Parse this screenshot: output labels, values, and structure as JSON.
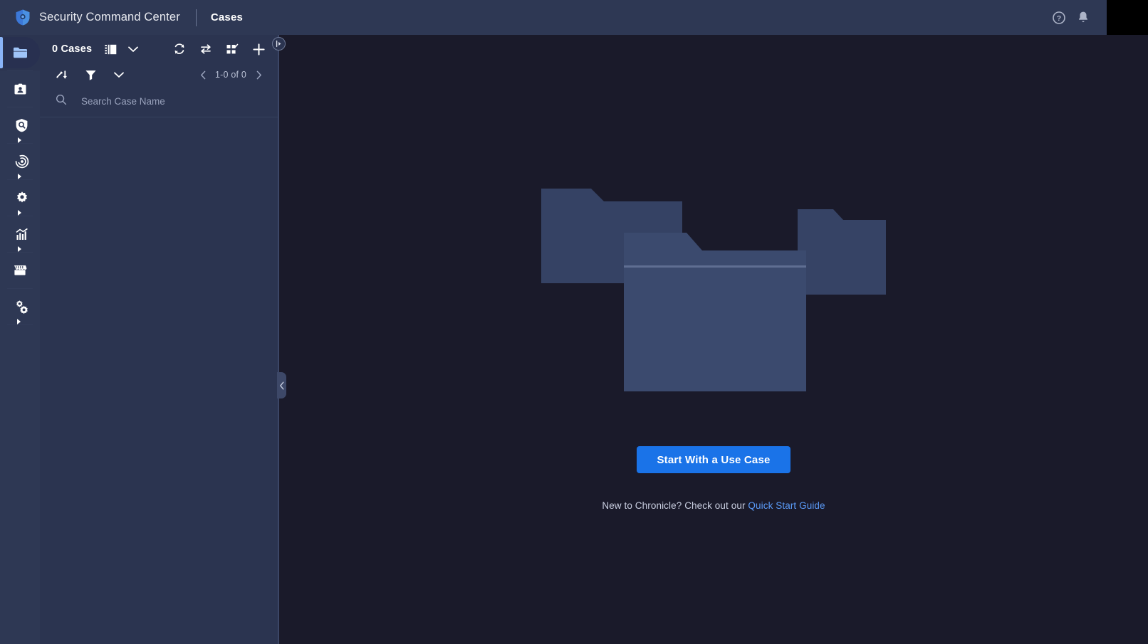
{
  "topbar": {
    "brand": "Security Command Center",
    "section": "Cases",
    "help_icon": "help-circle-icon",
    "notifications_icon": "bell-icon",
    "avatar": "user-avatar"
  },
  "sidebar": {
    "items": [
      {
        "id": "cases",
        "icon": "folder-icon",
        "active": true,
        "expandable": false
      },
      {
        "id": "contacts",
        "icon": "id-badge-icon",
        "active": false,
        "expandable": false
      },
      {
        "id": "investigate",
        "icon": "shield-search-icon",
        "active": false,
        "expandable": true
      },
      {
        "id": "detection",
        "icon": "radar-target-icon",
        "active": false,
        "expandable": true
      },
      {
        "id": "settings",
        "icon": "gear-icon",
        "active": false,
        "expandable": true
      },
      {
        "id": "reports",
        "icon": "bar-chart-icon",
        "active": false,
        "expandable": true
      },
      {
        "id": "marketplace",
        "icon": "storefront-icon",
        "active": false,
        "expandable": false
      },
      {
        "id": "soar-settings",
        "icon": "gears-cluster-icon",
        "active": false,
        "expandable": true
      }
    ]
  },
  "cases_panel": {
    "count_label": "0 Cases",
    "view_toggle_icon": "list-view-icon",
    "view_dropdown_icon": "chevron-down-icon",
    "refresh_icon": "refresh-icon",
    "transfer_icon": "swap-arrows-icon",
    "grid_icon": "grid-select-icon",
    "add_icon": "plus-icon",
    "sort_icon": "sort-icon",
    "filter_icon": "filter-funnel-icon",
    "filter_dropdown_icon": "chevron-down-icon",
    "pager": {
      "prev_icon": "chevron-left-icon",
      "range": "1-0 of 0",
      "next_icon": "chevron-right-icon"
    },
    "search": {
      "icon": "search-icon",
      "placeholder": "Search Case Name",
      "value": ""
    }
  },
  "splitter": {
    "top_handle_icon": "expand-right-icon",
    "mid_handle_icon": "collapse-left-icon"
  },
  "empty_state": {
    "illustration": "folders-illustration",
    "cta_label": "Start With a Use Case",
    "hint_prefix": "New to Chronicle? Check out our ",
    "hint_link": "Quick Start Guide"
  },
  "colors": {
    "app_background": "#1a1a2a",
    "panel_background": "#2b3450",
    "chrome_background": "#2e3854",
    "accent_blue": "#1a73e8",
    "link_blue": "#5b9bf8",
    "active_indicator": "#8ab4f8",
    "folder_front": "#394767",
    "folder_back": "#333f5e"
  }
}
